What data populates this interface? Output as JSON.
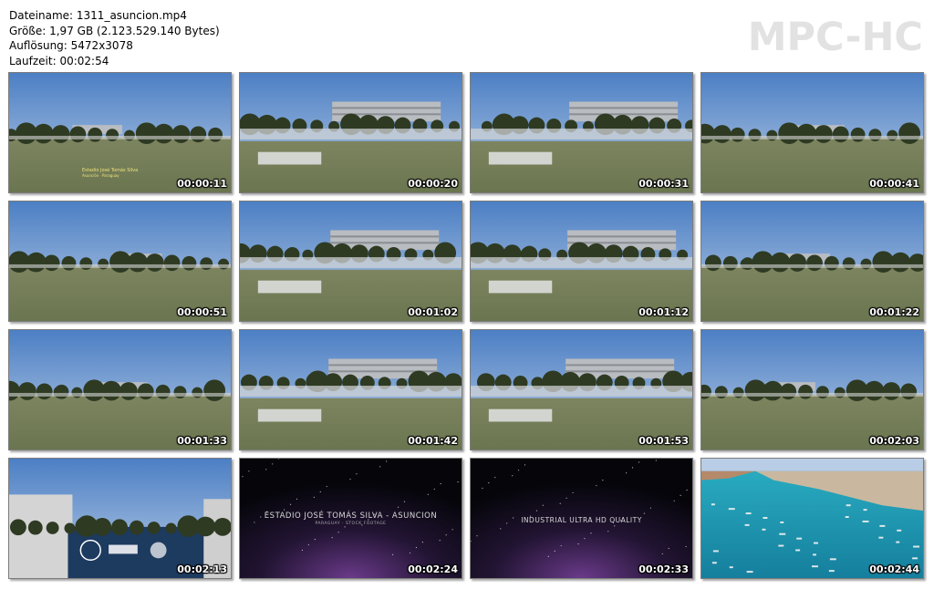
{
  "info": {
    "filename": "Dateiname: 1311_asuncion.mp4",
    "size": "Größe: 1,97 GB (2.123.529.140 Bytes)",
    "resolution": "Auflösung: 5472x3078",
    "duration": "Laufzeit: 00:02:54"
  },
  "logo": "MPC-HC",
  "thumbnails": [
    {
      "time": "00:00:11",
      "scene": "field"
    },
    {
      "time": "00:00:20",
      "scene": "buildings"
    },
    {
      "time": "00:00:31",
      "scene": "buildings"
    },
    {
      "time": "00:00:41",
      "scene": "field"
    },
    {
      "time": "00:00:51",
      "scene": "field"
    },
    {
      "time": "00:01:02",
      "scene": "buildings"
    },
    {
      "time": "00:01:12",
      "scene": "buildings"
    },
    {
      "time": "00:01:22",
      "scene": "field"
    },
    {
      "time": "00:01:33",
      "scene": "field"
    },
    {
      "time": "00:01:42",
      "scene": "buildings"
    },
    {
      "time": "00:01:53",
      "scene": "buildings"
    },
    {
      "time": "00:02:03",
      "scene": "field"
    },
    {
      "time": "00:02:13",
      "scene": "wall"
    },
    {
      "time": "00:02:24",
      "scene": "title-card"
    },
    {
      "time": "00:02:33",
      "scene": "tag-card"
    },
    {
      "time": "00:02:44",
      "scene": "harbor"
    }
  ],
  "cards": {
    "title": "ESTADIO JOSÉ TOMÁS SILVA - ASUNCION",
    "title_sub": "PARAGUAY · STOCK FOOTAGE",
    "tag": "INDUSTRIAL ULTRA HD QUALITY",
    "overlay_1": "Estadio José Tomás Silva",
    "overlay_2": "Asunción · Paraguay"
  },
  "colors": {
    "sky_top": "#4c7fc4",
    "sky_bottom": "#b9cde6",
    "grass": "#6a7650",
    "trees": "#2e3a22",
    "building": "#b9bcc1",
    "sea": "#1d9ab4"
  }
}
